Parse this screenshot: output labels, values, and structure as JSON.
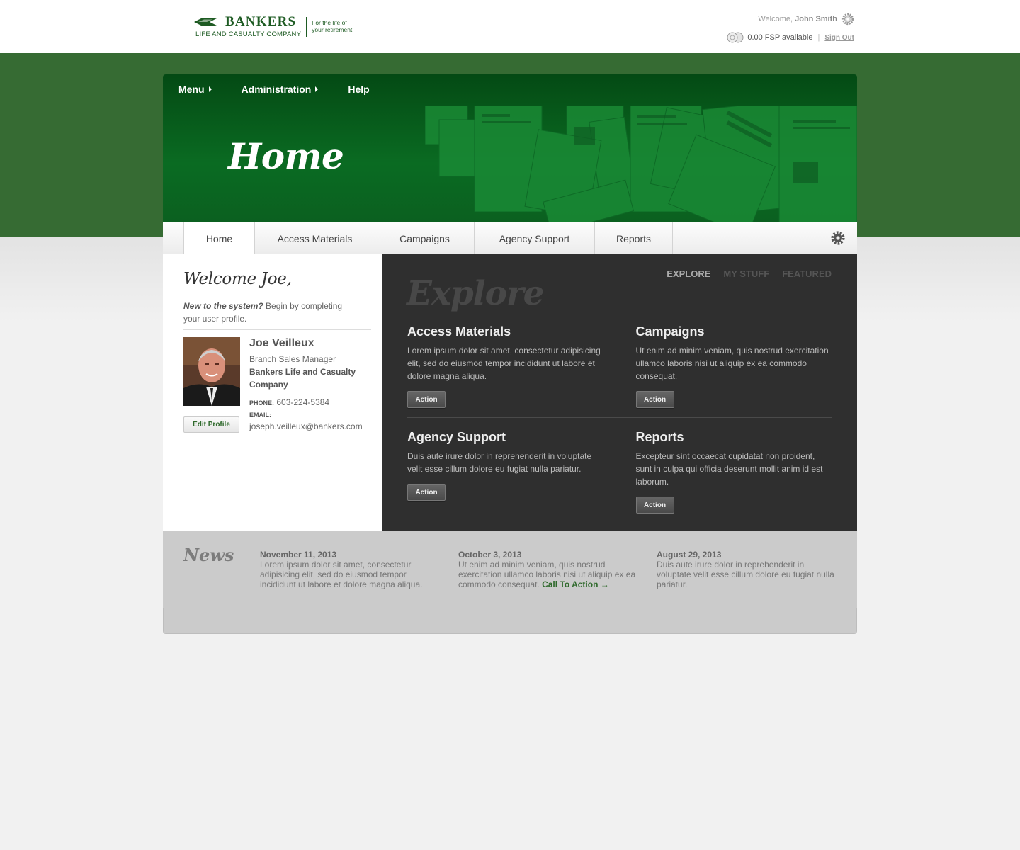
{
  "header": {
    "logo_name": "BANKERS",
    "logo_sub": "LIFE AND CASUALTY COMPANY",
    "logo_tag_1": "For the life of",
    "logo_tag_2": "your retirement",
    "welcome_prefix": "Welcome,",
    "user_name": "John Smith",
    "fsp": "0.00 FSP available",
    "separator": "|",
    "sign_out": "Sign Out"
  },
  "nav": {
    "menu": "Menu",
    "administration": "Administration",
    "help": "Help"
  },
  "hero": {
    "title": "Home"
  },
  "tabs": [
    {
      "label": "Home"
    },
    {
      "label": "Access Materials"
    },
    {
      "label": "Campaigns"
    },
    {
      "label": "Agency Support"
    },
    {
      "label": "Reports"
    }
  ],
  "left": {
    "welcome": "Welcome Joe,",
    "intro_em": "New to the system?",
    "intro_rest": " Begin by completing your user profile.",
    "name": "Joe Veilleux",
    "role": "Branch Sales Manager",
    "company": "Bankers Life and Casualty Company",
    "phone_label": "PHONE:",
    "phone": "603-224-5384",
    "email_label": "EMAIL:",
    "email": "joseph.veilleux@bankers.com",
    "edit_profile": "Edit Profile"
  },
  "explore": {
    "title": "Explore",
    "subtabs": [
      "EXPLORE",
      "MY STUFF",
      "FEATURED"
    ],
    "cards": [
      {
        "title": "Access Materials",
        "text": "Lorem ipsum dolor sit amet, consectetur adipisicing elit, sed do eiusmod tempor incididunt ut labore et dolore magna aliqua.",
        "action": "Action"
      },
      {
        "title": "Campaigns",
        "text": "Ut enim ad minim veniam, quis nostrud exercitation ullamco laboris nisi ut aliquip ex ea commodo consequat.",
        "action": "Action"
      },
      {
        "title": "Agency Support",
        "text": "Duis aute irure dolor in reprehenderit in voluptate velit esse cillum dolore eu fugiat nulla pariatur.",
        "action": "Action"
      },
      {
        "title": "Reports",
        "text": "Excepteur sint occaecat cupidatat non proident, sunt in culpa qui officia deserunt mollit anim id est laborum.",
        "action": "Action"
      }
    ]
  },
  "news": {
    "title": "News",
    "items": [
      {
        "date": "November 11, 2013",
        "text": "Lorem ipsum dolor sit amet, consectetur adipisicing elit, sed do eiusmod tempor incididunt ut labore et dolore magna aliqua."
      },
      {
        "date": "October 3, 2013",
        "text": "Ut enim ad minim veniam, quis nostrud exercitation ullamco laboris nisi ut aliquip ex ea commodo consequat.",
        "cta": "Call To Action →"
      },
      {
        "date": "August 29, 2013",
        "text": "Duis aute irure dolor in reprehenderit in voluptate velit esse cillum dolore eu fugiat nulla pariatur."
      }
    ]
  },
  "colors": {
    "brand_green": "#366b33",
    "hero_green": "#0a6b22",
    "dark_panel": "#2f2f2f"
  }
}
